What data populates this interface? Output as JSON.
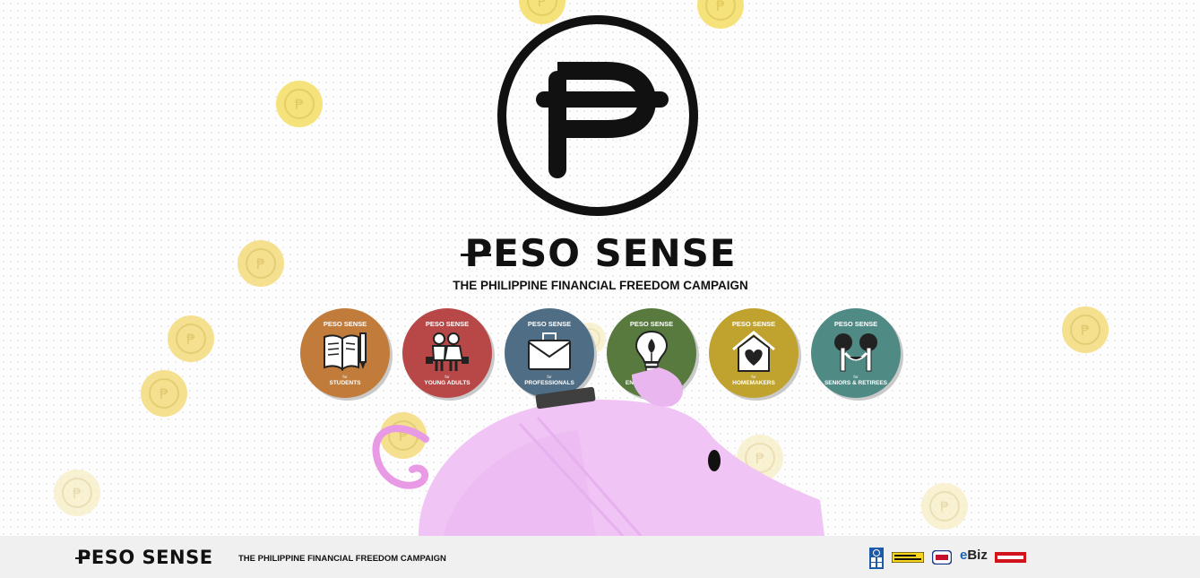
{
  "brand": {
    "name_peso_char": "P",
    "name_rest": "ESO SENSE",
    "tagline": "THE PHILIPPINE FINANCIAL FREEDOM CAMPAIGN"
  },
  "categories": [
    {
      "brand": "PESO SENSE",
      "for": "for",
      "label": "STUDENTS",
      "color": "#c17b3a",
      "icon": "book-pencil-icon"
    },
    {
      "brand": "PESO SENSE",
      "for": "for",
      "label": "YOUNG ADULTS",
      "color": "#b84848",
      "icon": "young-adults-icon"
    },
    {
      "brand": "PESO SENSE",
      "for": "for",
      "label": "PROFESSIONALS",
      "color": "#4f6d84",
      "icon": "briefcase-icon"
    },
    {
      "brand": "PESO SENSE",
      "for": "for",
      "label": "ENTREPRENEURS",
      "color": "#587a3e",
      "icon": "lightbulb-icon"
    },
    {
      "brand": "PESO SENSE",
      "for": "for",
      "label": "HOMEMAKERS",
      "color": "#c0a22e",
      "icon": "house-heart-icon"
    },
    {
      "brand": "PESO SENSE",
      "for": "for",
      "label": "SENIORS & RETIREES",
      "color": "#4f8a85",
      "icon": "trees-hammock-icon"
    }
  ],
  "footer": {
    "brand_peso_char": "P",
    "brand_rest": "ESO SENSE",
    "tagline": "THE PHILIPPINE FINANCIAL FREEDOM CAMPAIGN",
    "partners": [
      {
        "name": "UNDP",
        "icon": "undp-logo"
      },
      {
        "name": "WESTERN UNION",
        "icon": "western-union-logo"
      },
      {
        "name": "",
        "icon": "partner-seal-logo"
      },
      {
        "name": "eBiz",
        "icon": "ebiz-logo"
      },
      {
        "name": "PETNET",
        "icon": "petnet-logo"
      }
    ]
  },
  "colors": {
    "coin": "#f6e27a",
    "coin_faded": "#f7edc4",
    "pig": "#f0c4f5",
    "pig_dark": "#e7b0ee",
    "ink": "#111111"
  }
}
